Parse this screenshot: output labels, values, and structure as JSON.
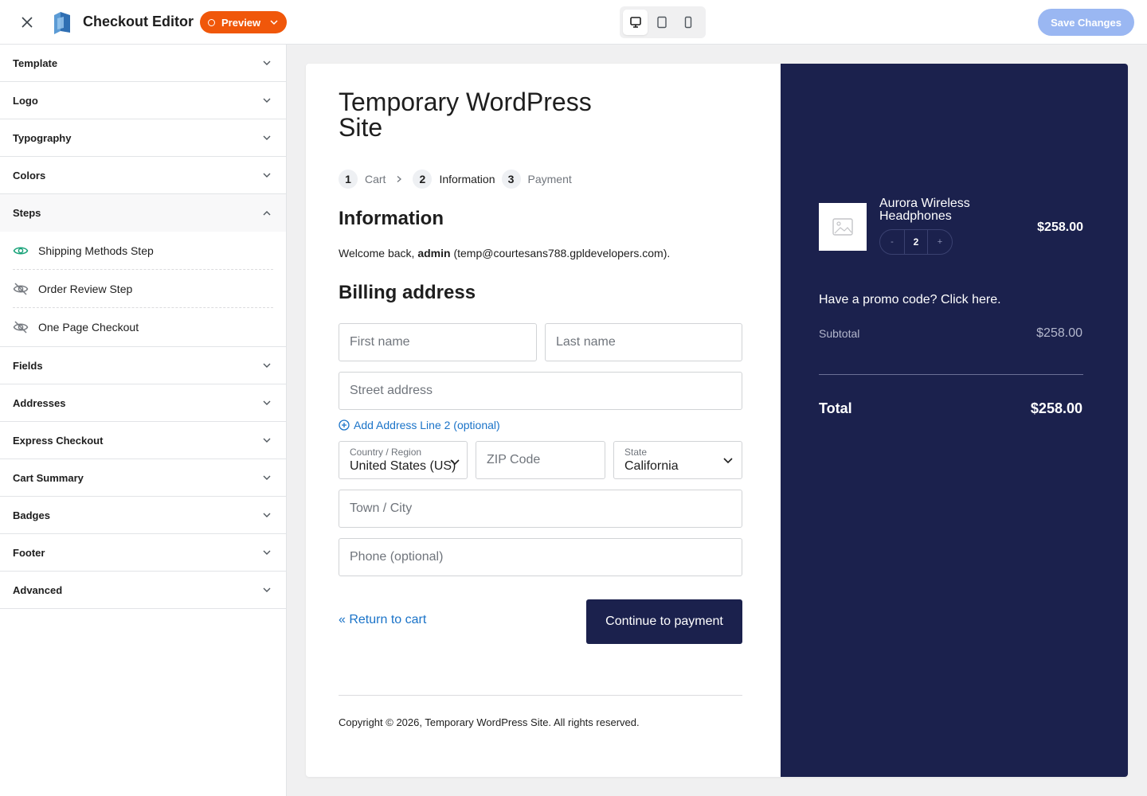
{
  "topbar": {
    "title": "Checkout Editor",
    "preview_label": "Preview",
    "save_label": "Save Changes",
    "accent_color": "#f0570a"
  },
  "sidebar": {
    "sections_top": [
      {
        "label": "Template"
      },
      {
        "label": "Logo"
      },
      {
        "label": "Typography"
      },
      {
        "label": "Colors"
      }
    ],
    "steps_section": {
      "label": "Steps",
      "items": [
        {
          "label": "Shipping Methods Step",
          "visible": true,
          "icon": "eye-icon"
        },
        {
          "label": "Order Review Step",
          "visible": false,
          "icon": "eye-off-icon"
        },
        {
          "label": "One Page Checkout",
          "visible": false,
          "icon": "eye-off-icon"
        }
      ]
    },
    "sections_bottom": [
      {
        "label": "Fields"
      },
      {
        "label": "Addresses"
      },
      {
        "label": "Express Checkout"
      },
      {
        "label": "Cart Summary"
      },
      {
        "label": "Badges"
      },
      {
        "label": "Footer"
      },
      {
        "label": "Advanced"
      }
    ]
  },
  "checkout": {
    "site_title": "Temporary WordPress Site",
    "breadcrumbs": [
      {
        "num": "1",
        "label": "Cart"
      },
      {
        "num": "2",
        "label": "Information"
      },
      {
        "num": "3",
        "label": "Payment"
      }
    ],
    "info_heading": "Information",
    "welcome_prefix": "Welcome back, ",
    "welcome_user": "admin",
    "welcome_email": " (temp@courtesans788.gpldevelopers.com).",
    "billing_heading": "Billing address",
    "fields": {
      "first_name": "First name",
      "last_name": "Last name",
      "street": "Street address",
      "zip": "ZIP Code",
      "city": "Town / City",
      "phone": "Phone (optional)"
    },
    "add_line2": "Add Address Line 2 (optional)",
    "country_label": "Country / Region",
    "country_value": "United States (US)",
    "state_label": "State",
    "state_value": "California",
    "return_link": "« Return to cart",
    "continue_label": "Continue to payment",
    "copyright": "Copyright © 2026, Temporary WordPress Site. All rights reserved."
  },
  "summary": {
    "product_name": "Aurora Wireless Headphones",
    "qty_minus": "-",
    "qty_value": "2",
    "qty_plus": "+",
    "product_price": "$258.00",
    "promo": "Have a promo code? Click here.",
    "subtotal_label": "Subtotal",
    "subtotal_value": "$258.00",
    "total_label": "Total",
    "total_value": "$258.00",
    "bg_color": "#1b214d"
  }
}
